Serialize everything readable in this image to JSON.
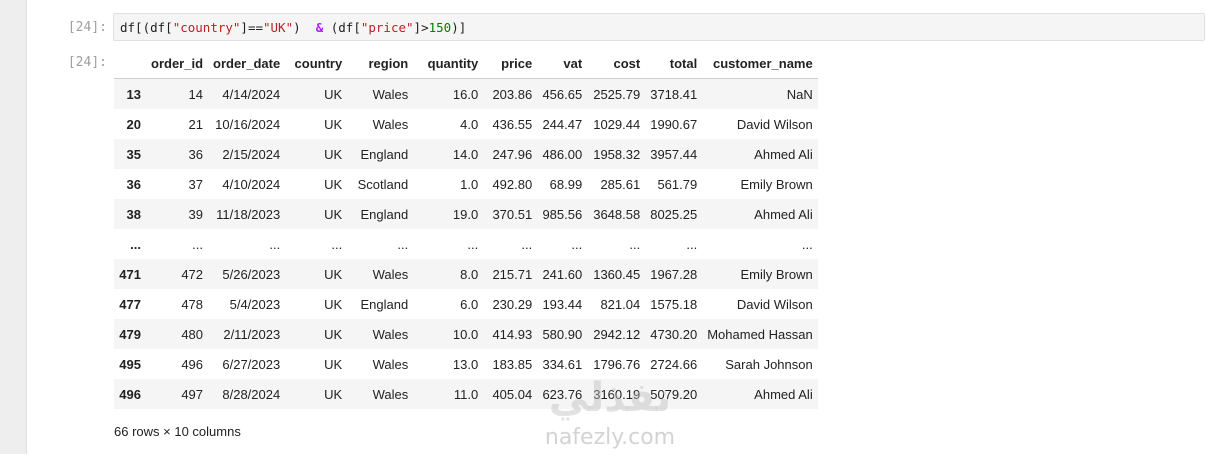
{
  "input_cell": {
    "prompt": "[24]:",
    "code": {
      "p1": "df[(df[",
      "s1": "\"country\"",
      "p2": "]==",
      "s2": "\"UK\"",
      "p3": ")  ",
      "op": "&",
      "p4": " (df[",
      "s3": "\"price\"",
      "p5": "]>",
      "n1": "150",
      "p6": ")]"
    }
  },
  "output_cell": {
    "prompt": "[24]:",
    "columns": [
      "order_id",
      "order_date",
      "country",
      "region",
      "quantity",
      "price",
      "vat",
      "cost",
      "total",
      "customer_name"
    ],
    "rows": [
      {
        "index": "13",
        "cells": [
          "14",
          "4/14/2024",
          "UK",
          "Wales",
          "16.0",
          "203.86",
          "456.65",
          "2525.79",
          "3718.41",
          "NaN"
        ]
      },
      {
        "index": "20",
        "cells": [
          "21",
          "10/16/2024",
          "UK",
          "Wales",
          "4.0",
          "436.55",
          "244.47",
          "1029.44",
          "1990.67",
          "David Wilson"
        ]
      },
      {
        "index": "35",
        "cells": [
          "36",
          "2/15/2024",
          "UK",
          "England",
          "14.0",
          "247.96",
          "486.00",
          "1958.32",
          "3957.44",
          "Ahmed Ali"
        ]
      },
      {
        "index": "36",
        "cells": [
          "37",
          "4/10/2024",
          "UK",
          "Scotland",
          "1.0",
          "492.80",
          "68.99",
          "285.61",
          "561.79",
          "Emily Brown"
        ]
      },
      {
        "index": "38",
        "cells": [
          "39",
          "11/18/2023",
          "UK",
          "England",
          "19.0",
          "370.51",
          "985.56",
          "3648.58",
          "8025.25",
          "Ahmed Ali"
        ]
      },
      {
        "index": "...",
        "cells": [
          "...",
          "...",
          "...",
          "...",
          "...",
          "...",
          "...",
          "...",
          "...",
          "..."
        ]
      },
      {
        "index": "471",
        "cells": [
          "472",
          "5/26/2023",
          "UK",
          "Wales",
          "8.0",
          "215.71",
          "241.60",
          "1360.45",
          "1967.28",
          "Emily Brown"
        ]
      },
      {
        "index": "477",
        "cells": [
          "478",
          "5/4/2023",
          "UK",
          "England",
          "6.0",
          "230.29",
          "193.44",
          "821.04",
          "1575.18",
          "David Wilson"
        ]
      },
      {
        "index": "479",
        "cells": [
          "480",
          "2/11/2023",
          "UK",
          "Wales",
          "10.0",
          "414.93",
          "580.90",
          "2942.12",
          "4730.20",
          "Mohamed Hassan"
        ]
      },
      {
        "index": "495",
        "cells": [
          "496",
          "6/27/2023",
          "UK",
          "Wales",
          "13.0",
          "183.85",
          "334.61",
          "1796.76",
          "2724.66",
          "Sarah Johnson"
        ]
      },
      {
        "index": "496",
        "cells": [
          "497",
          "8/28/2024",
          "UK",
          "Wales",
          "11.0",
          "405.04",
          "623.76",
          "3160.19",
          "5079.20",
          "Ahmed Ali"
        ]
      }
    ],
    "shape": "66 rows × 10 columns"
  },
  "watermark": {
    "logo": "نفذلي",
    "text": "nafezly.com"
  }
}
